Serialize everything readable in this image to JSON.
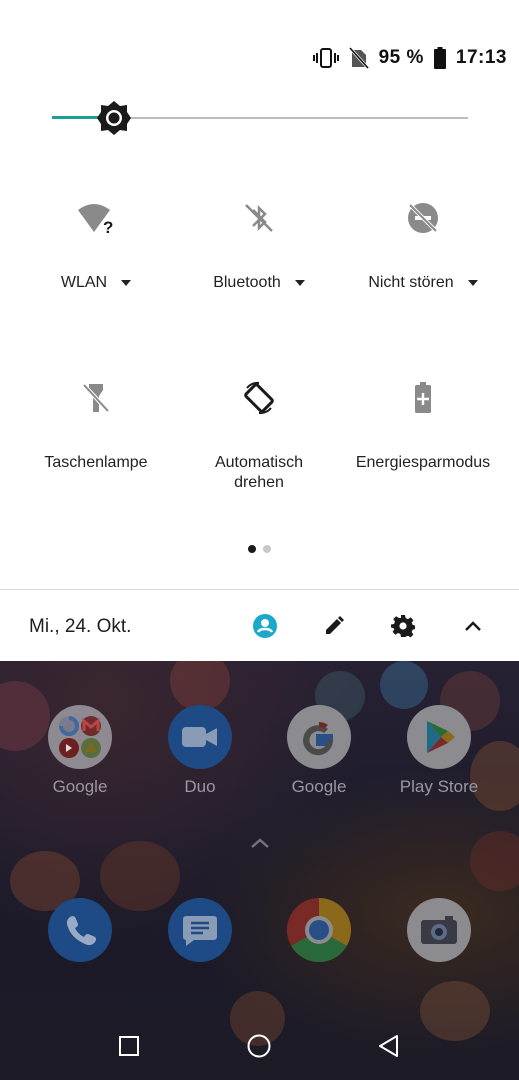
{
  "status_bar": {
    "battery_percent": "95 %",
    "time": "17:13",
    "icons": [
      "vibrate-icon",
      "no-sim-icon",
      "battery-icon"
    ]
  },
  "brightness": {
    "level": 0.15
  },
  "tiles": [
    {
      "label": "WLAN",
      "icon": "wifi-unknown-icon",
      "has_dropdown": true
    },
    {
      "label": "Bluetooth",
      "icon": "bluetooth-off-icon",
      "has_dropdown": true
    },
    {
      "label": "Nicht stören",
      "icon": "do-not-disturb-off-icon",
      "has_dropdown": true
    },
    {
      "label": "Taschenlampe",
      "icon": "flashlight-off-icon",
      "has_dropdown": false
    },
    {
      "label": "Automatisch drehen",
      "icon": "auto-rotate-icon",
      "has_dropdown": false
    },
    {
      "label": "Energiesparmodus",
      "icon": "battery-saver-icon",
      "has_dropdown": false
    }
  ],
  "pager": {
    "pages": 2,
    "current": 1
  },
  "footer": {
    "date": "Mi., 24. Okt.",
    "icons": [
      "user-icon",
      "edit-icon",
      "settings-icon",
      "collapse-icon"
    ],
    "accent": "#1aa9c8"
  },
  "home": {
    "apps_row1": [
      {
        "label": "Google",
        "icon": "google-folder-icon"
      },
      {
        "label": "Duo",
        "icon": "duo-icon"
      },
      {
        "label": "Google",
        "icon": "google-icon"
      },
      {
        "label": "Play Store",
        "icon": "play-store-icon"
      }
    ],
    "dock": [
      {
        "icon": "phone-icon"
      },
      {
        "icon": "messages-icon"
      },
      {
        "icon": "chrome-icon"
      },
      {
        "icon": "camera-icon"
      }
    ]
  },
  "navbar": {
    "buttons": [
      "recents-button",
      "home-button",
      "back-button"
    ]
  },
  "colors": {
    "slider_accent": "#1a9e98",
    "tile_inactive": "#8a8a8a",
    "tile_active": "#1a1a1a"
  }
}
